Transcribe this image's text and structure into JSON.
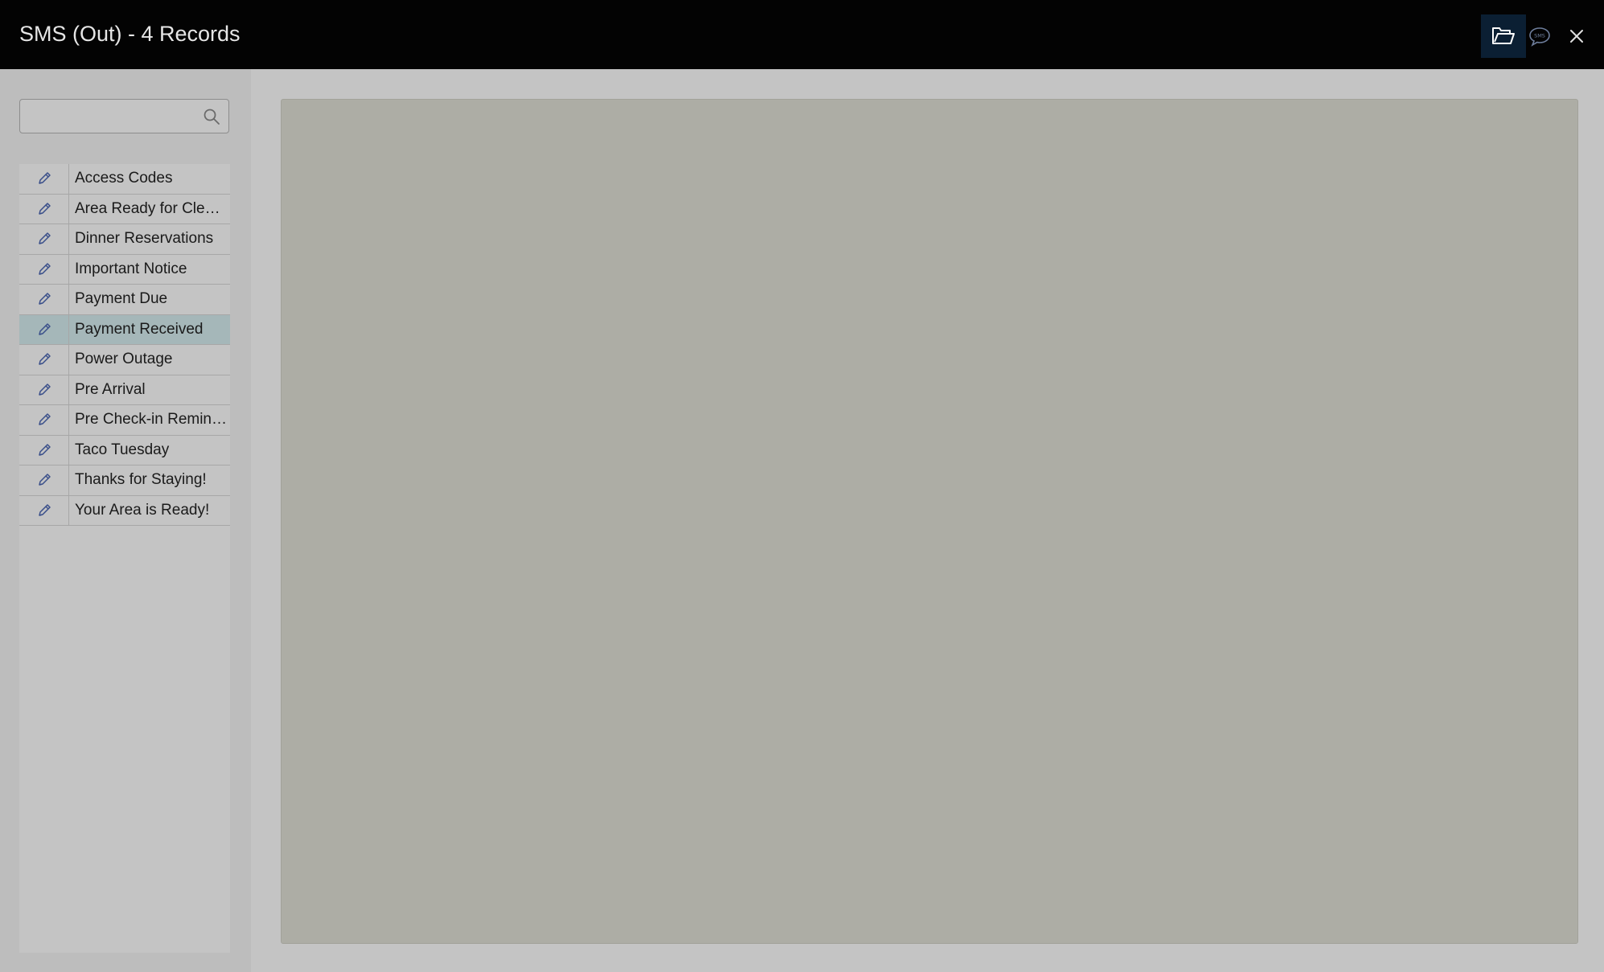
{
  "window": {
    "title": "SMS (Out) - 4 Records"
  },
  "toolbar": {
    "folder_icon": "folder-open-icon",
    "sms_icon": "sms-chat-icon",
    "close_icon": "close-icon"
  },
  "search": {
    "value": "",
    "placeholder": ""
  },
  "templates": [
    {
      "label": "Access Codes"
    },
    {
      "label": "Area Ready for Clean..."
    },
    {
      "label": "Dinner Reservations"
    },
    {
      "label": "Important Notice"
    },
    {
      "label": "Payment Due"
    },
    {
      "label": "Payment Received",
      "selected": true
    },
    {
      "label": "Power Outage"
    },
    {
      "label": "Pre Arrival"
    },
    {
      "label": "Pre Check-in Reminder"
    },
    {
      "label": "Taco Tuesday"
    },
    {
      "label": "Thanks for Staying!"
    },
    {
      "label": "Your Area is Ready!"
    }
  ],
  "colors": {
    "titlebar": "#030303",
    "selected_row": "#a5b7b9",
    "accent_icon": "#3a4f8a"
  }
}
